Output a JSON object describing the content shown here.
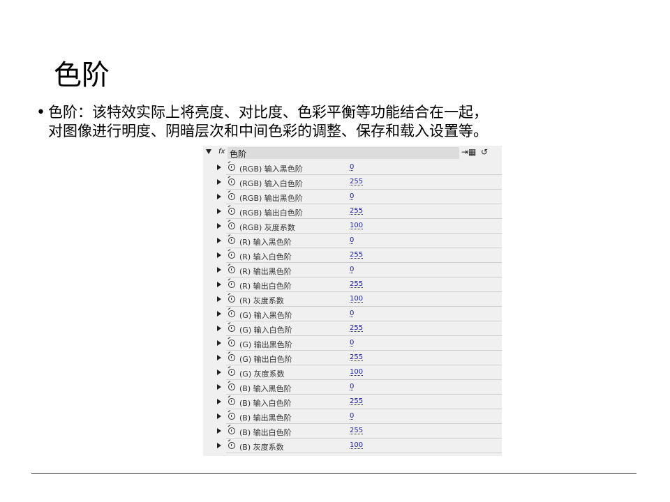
{
  "slide": {
    "title": "色阶",
    "bullet_lines": [
      "色阶：该特效实际上将亮度、对比度、色彩平衡等功能结合在一起，",
      "对图像进行明度、阴暗层次和中间色彩的调整、保存和载入设置等。"
    ]
  },
  "panel": {
    "fx_badge": "fx",
    "effect_name": "色阶",
    "tool_icons": [
      "histogram-icon",
      "reset-icon"
    ],
    "tool_glyphs": [
      "⇥▦",
      "↺"
    ],
    "params": [
      {
        "name": "(RGB) 输入黑色阶",
        "value": "0"
      },
      {
        "name": "(RGB) 输入白色阶",
        "value": "255"
      },
      {
        "name": "(RGB) 输出黑色阶",
        "value": "0"
      },
      {
        "name": "(RGB) 输出白色阶",
        "value": "255"
      },
      {
        "name": "(RGB) 灰度系数",
        "value": "100"
      },
      {
        "name": "(R) 输入黑色阶",
        "value": "0"
      },
      {
        "name": "(R) 输入白色阶",
        "value": "255"
      },
      {
        "name": "(R) 输出黑色阶",
        "value": "0"
      },
      {
        "name": "(R) 输出白色阶",
        "value": "255"
      },
      {
        "name": "(R) 灰度系数",
        "value": "100"
      },
      {
        "name": "(G) 输入黑色阶",
        "value": "0"
      },
      {
        "name": "(G) 输入白色阶",
        "value": "255"
      },
      {
        "name": "(G) 输出黑色阶",
        "value": "0"
      },
      {
        "name": "(G) 输出白色阶",
        "value": "255"
      },
      {
        "name": "(G) 灰度系数",
        "value": "100"
      },
      {
        "name": "(B) 输入黑色阶",
        "value": "0"
      },
      {
        "name": "(B) 输入白色阶",
        "value": "255"
      },
      {
        "name": "(B) 输出黑色阶",
        "value": "0"
      },
      {
        "name": "(B) 输出白色阶",
        "value": "255"
      },
      {
        "name": "(B) 灰度系数",
        "value": "100"
      }
    ]
  },
  "colors": {
    "value_link": "#1a1ab0",
    "panel_bg": "#f0f0f0",
    "header_bar": "#dcdcdc"
  }
}
